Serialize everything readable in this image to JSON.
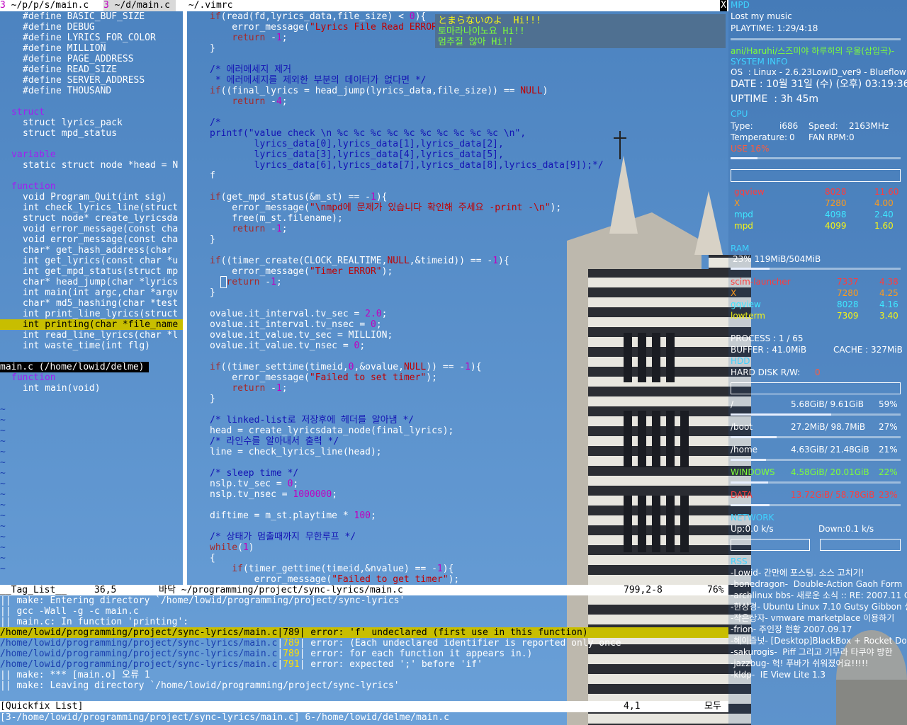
{
  "tabs": [
    {
      "num": "3",
      "label": " ~/p/p/s/main.c "
    },
    {
      "num": "3",
      "label": " ~/d/main.c "
    },
    {
      "label": " ~/.vimrc"
    }
  ],
  "tab_close": "X",
  "taglist": {
    "defines": [
      "#define BASIC_BUF_SIZE",
      "#define DEBUG",
      "#define LYRICS_FOR_COLOR",
      "#define MILLION",
      "#define PAGE_ADDRESS",
      "#define READ_SIZE",
      "#define SERVER_ADDRESS",
      "#define THOUSAND"
    ],
    "struct_header": "struct",
    "structs": [
      "struct lyrics_pack",
      "struct mpd_status"
    ],
    "variable_header": "variable",
    "variables": [
      "static struct node *head = N"
    ],
    "function_header": "function",
    "functions": [
      "void Program_Quit(int sig)",
      "int check_lyrics_line(struct",
      "struct node* create_lyricsda",
      "void error_message(const cha",
      "void error_message(const cha",
      "char* get_hash_address(char ",
      "int get_lyrics(const char *u",
      "int get_mpd_status(struct mp",
      "char* head_jump(char *lyrics",
      "int main(int argc,char *argv",
      "char* md5_hashing(char *test",
      "int print_line_lyrics(struct",
      "int printing(char *file_name",
      "int read_line_lyrics(char *l",
      "int waste_time(int flg)"
    ],
    "file2": "main.c (/home/lowid/delme)",
    "function2_header": "function",
    "functions2": [
      "int main(void)"
    ],
    "tilde": "~"
  },
  "code_lines": [
    "if(read(fd,lyrics_data,file_size) < 0){",
    "    error_message(\"Lyrics File Read ERROR\");",
    "    return -1;",
    "}",
    "",
    "/* 에러메세지 제거",
    " * 에러메세지를 제외한 부분의 데이터가 없다면 */",
    "if((final_lyrics = head_jump(lyrics_data,file_size)) == NULL)",
    "    return -4;",
    "",
    "/*",
    "printf(\"value check \\n %c %c %c %c %c %c %c %c %c %c \\n\",",
    "        lyrics_data[0],lyrics_data[1],lyrics_data[2],",
    "        lyrics_data[3],lyrics_data[4],lyrics_data[5],",
    "        lyrics_data[6],lyrics_data[7],lyrics_data[8],lyrics_data[9]);*/",
    "f",
    "",
    "if(get_mpd_status(&m_st) == -1){",
    "    error_message(\"\\nmpd에 문제가 있습니다 확인해 주세요 -print -\\n\");",
    "    free(m_st.filename);",
    "    return -1;",
    "}",
    "",
    "if((timer_create(CLOCK_REALTIME,NULL,&timeid)) == -1){",
    "    error_message(\"Timer ERROR\");",
    "    return -1;",
    "}",
    "",
    "ovalue.it_interval.tv_sec = 2.0;",
    "ovalue.it_interval.tv_nsec = 0;",
    "ovalue.it_value.tv_sec = MILLION;",
    "ovalue.it_value.tv_nsec = 0;",
    "",
    "if((timer_settime(timeid,0,&ovalue,NULL)) == -1){",
    "    error_message(\"Failed to set timer\");",
    "    return -1;",
    "}",
    "",
    "/* linked-list로 저장후에 헤더를 알아냄 */",
    "head = create_lyricsdata_node(final_lyrics);",
    "/* 라인수를 알아내서 출력 */",
    "line = check_lyrics_line(head);",
    "",
    "/* sleep time */",
    "nslp.tv_sec = 0;",
    "nslp.tv_nsec = 1000000;",
    "",
    "diftime = m_st.playtime * 100;",
    "",
    "/* 상태가 멈출때까지 무한루프 */",
    "while(1)",
    "{",
    "    if(timer_gettime(timeid,&nvalue) == -1){",
    "        error_message(\"Failed to get timer\");"
  ],
  "status": {
    "left": "__Tag_List__     36,5",
    "mid": "바닥 ~/programming/project/sync-lyrics/main.c",
    "pos": "799,2-8",
    "pct": "76%"
  },
  "quickfix": {
    "lines": [
      {
        "text": "|| make: Entering directory `/home/lowid/programming/project/sync-lyrics'"
      },
      {
        "text": "|| gcc -Wall -g -c main.c"
      },
      {
        "text": "|| main.c: In function 'printing':"
      },
      {
        "path": "/home/lowid/programming/project/sync-lyrics/main.c",
        "line": "789",
        "msg": " error: 'f' undeclared (first use in this function)",
        "hl": true
      },
      {
        "path": "/home/lowid/programming/project/sync-lyrics/main.c",
        "line": "789",
        "msg": " error: (Each undeclared identifier is reported only once"
      },
      {
        "path": "/home/lowid/programming/project/sync-lyrics/main.c",
        "line": "789",
        "msg": " error: for each function it appears in.)"
      },
      {
        "path": "/home/lowid/programming/project/sync-lyrics/main.c",
        "line": "791",
        "msg": " error: expected ';' before 'if'"
      },
      {
        "text": "|| make: *** [main.o] 오류 1"
      },
      {
        "text": "|| make: Leaving directory `/home/lowid/programming/project/sync-lyrics'"
      }
    ],
    "status_left": "[Quickfix List]",
    "status_pos": "4,1",
    "status_right": "모두"
  },
  "cmdline": "[3-/home/lowid/programming/project/sync-lyrics/main.c] 6-/home/lowid/delme/main.c",
  "osd": [
    "とまらないのよ  Hi!!!",
    "토마라나이노요 Hi!!",
    "멈추질 않아 Hi!!"
  ],
  "conky": {
    "mpd_title": "MPD",
    "song": "Lost my music",
    "playtime": "PLAYTIME: 1:29/4:18",
    "playing": "ani/Haruhi/스즈미야 하루히의 우울(삽입곡)-",
    "sysinfo_title": "SYSTEM INFO",
    "os": "OS  : Linux - 2.6.23LowID_ver9 - Blueflow",
    "date": "DATE : 10월 31일 (수) (오후) 03:19:36",
    "uptime": "UPTIME  : 3h 45m",
    "cpu_title": "CPU",
    "type_label": "Type:",
    "type_value": "i686",
    "speed_label": "Speed:",
    "speed_value": "2163MHz",
    "temp_label": "Temperature:",
    "temp_value": "0",
    "fan_label": "FAN RPM:",
    "fan_value": "0",
    "use_label": "USE 16%",
    "cpu_usage": 0.16,
    "cpu_procs": [
      {
        "name": "gqview",
        "pid": "8028",
        "val": "11.60"
      },
      {
        "name": "X",
        "pid": "7280",
        "val": "4.00"
      },
      {
        "name": "mpd",
        "pid": "4098",
        "val": "2.40"
      },
      {
        "name": "mpd",
        "pid": "4099",
        "val": "1.60"
      }
    ],
    "ram_title": "RAM",
    "ram": "23% 119MiB/504MiB",
    "ram_usage": 0.23,
    "mem_procs": [
      {
        "name": "scim-launcher",
        "pid": "7337",
        "val": "4.38"
      },
      {
        "name": "X",
        "pid": "7280",
        "val": "4.25"
      },
      {
        "name": "gqview",
        "pid": "8028",
        "val": "4.16"
      },
      {
        "name": "lowterm",
        "pid": "7309",
        "val": "3.40"
      }
    ],
    "process": "PROCESS : 1 / 65",
    "buffer": "BUFFER : 41.0MiB",
    "cache": "CACHE : 327MiB",
    "hdd_title": "HDD",
    "hdd_rw_label": "HARD DISK R/W:",
    "hdd_rw_value": "0",
    "disks": [
      {
        "name": "/",
        "size": "5.68GiB/ 9.61GiB",
        "pct": "59%",
        "usage": 0.59
      },
      {
        "name": "/boot",
        "size": "27.2MiB/ 98.7MiB",
        "pct": "27%",
        "usage": 0.27
      },
      {
        "name": "/home",
        "size": "4.63GiB/ 21.48GiB",
        "pct": "21%",
        "usage": 0.21
      },
      {
        "name": "WINDOWS",
        "size": "4.58GiB/ 20.01GiB",
        "pct": "22%",
        "usage": 0.22
      },
      {
        "name": "DATA",
        "size": "13.72GiB/ 58.78GiB",
        "pct": "23%",
        "usage": 0.23
      }
    ],
    "network_title": "NETWORK",
    "up": "Up:0.0 k/s",
    "down": "Down:0.1 k/s",
    "rss_title": "RSS",
    "rss": [
      "-Lowid- 간만에 포스팅. 소스 고치기!",
      "-bonedragon-  Double-Action Gaoh Form",
      "-archlinux bbs- 새로운 소식 :: RE: 2007.11 Co",
      "-한상경- Ubuntu Linux 7.10 Gutsy Gibbon 설",
      "-작은상자- vmware marketplace 이용하기",
      "-frion- 주인장 현황 2007.09.17",
      "-헤이즐넛- [Desktop]BlackBox + Rocket Dock",
      "-sakurogis-  Piff 그리고 기무라 타쿠야 방한",
      "-jazzbug- 헉! 푸바가 쉬워졌어요!!!!!",
      "-kldp-  IE View Lite 1.3"
    ]
  },
  "colors": {
    "background": "#4f86c2",
    "keyword": "#a52a2a",
    "string": "#c00000",
    "comment": "#1414b4",
    "conky_header": "#3fd2ff",
    "highlight": "#c8be00"
  }
}
